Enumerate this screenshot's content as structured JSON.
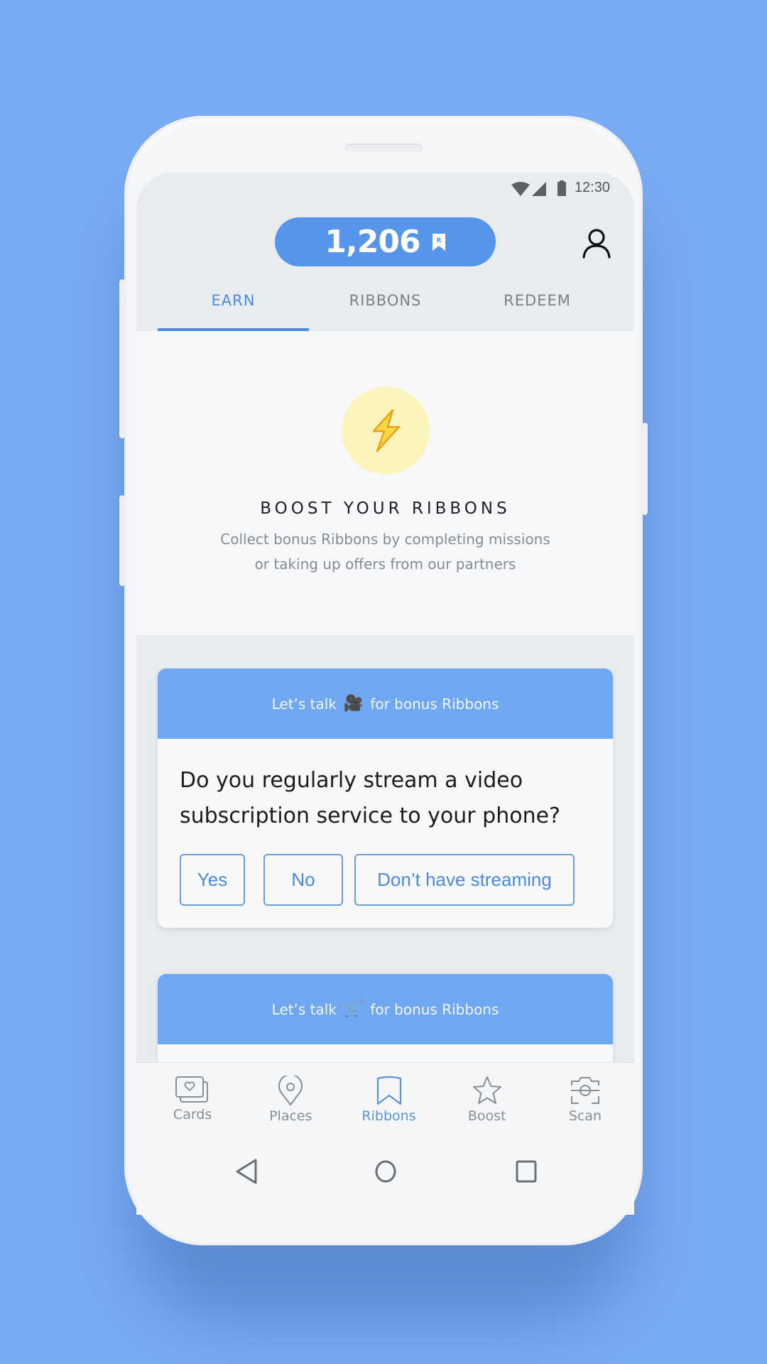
{
  "status_bar": {
    "time": "12:30",
    "icons": [
      "wifi-icon",
      "cell-signal-icon",
      "battery-icon"
    ]
  },
  "header": {
    "points": "1,206",
    "points_icon": "ribbon-r-icon",
    "profile_icon": "person-icon"
  },
  "tabs": [
    {
      "label": "EARN",
      "active": true
    },
    {
      "label": "RIBBONS",
      "active": false
    },
    {
      "label": "REDEEM",
      "active": false
    }
  ],
  "hero": {
    "icon": "lightning-bolt-icon",
    "title": "BOOST YOUR RIBBONS",
    "subtitle_line1": "Collect bonus Ribbons by completing missions",
    "subtitle_line2": "or taking up offers from our partners"
  },
  "cards": [
    {
      "head_prefix": "Let’s talk",
      "head_emoji": "🎥",
      "head_suffix": "for bonus Ribbons",
      "question": "Do you regularly stream a video subscription service to your phone?",
      "answers": [
        "Yes",
        "No",
        "Don’t have streaming"
      ]
    },
    {
      "head_prefix": "Let’s talk",
      "head_emoji": "🛒",
      "head_suffix": "for bonus Ribbons"
    }
  ],
  "bottom_nav": [
    {
      "label": "Cards",
      "icon": "cards-heart-icon",
      "active": false
    },
    {
      "label": "Places",
      "icon": "location-pin-icon",
      "active": false
    },
    {
      "label": "Ribbons",
      "icon": "bookmark-ribbon-icon",
      "active": true
    },
    {
      "label": "Boost",
      "icon": "star-icon",
      "active": false
    },
    {
      "label": "Scan",
      "icon": "scan-camera-icon",
      "active": false
    }
  ],
  "colors": {
    "background": "#79abf3",
    "accent": "#4a8ae0",
    "pill": "#5595ea",
    "card_header": "#6fa7f0",
    "bolt_circle": "#fbf5bd"
  }
}
